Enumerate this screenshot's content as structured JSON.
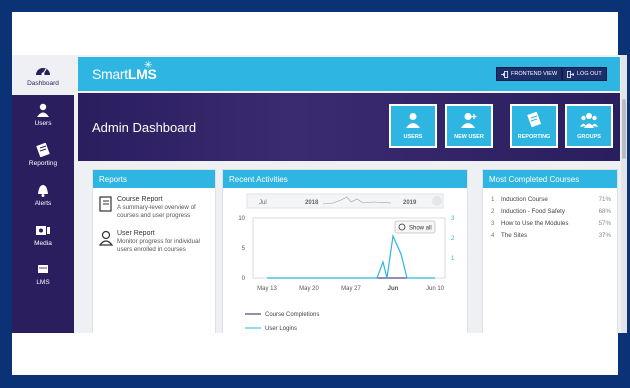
{
  "sidebar": {
    "items": [
      {
        "label": "Dashboard",
        "icon": "dashboard-icon"
      },
      {
        "label": "Users",
        "icon": "user-icon"
      },
      {
        "label": "Reporting",
        "icon": "reporting-icon"
      },
      {
        "label": "Alerts",
        "icon": "bell-icon"
      },
      {
        "label": "Media",
        "icon": "media-icon"
      }
    ],
    "lms_label": "LMS"
  },
  "topbar": {
    "logo_light": "Smart",
    "logo_bold": "LMS",
    "frontend_label": "FRONTEND VIEW",
    "logout_label": "LOG OUT"
  },
  "banner": {
    "title": "Admin Dashboard",
    "tiles": [
      {
        "label": "USERS",
        "icon": "user-icon"
      },
      {
        "label": "NEW USER",
        "icon": "add-user-icon"
      },
      {
        "label": "REPORTING",
        "icon": "reporting-icon"
      },
      {
        "label": "GROUPS",
        "icon": "groups-icon"
      }
    ]
  },
  "reports": {
    "title": "Reports",
    "items": [
      {
        "title": "Course Report",
        "desc": "A summary-level overview of courses and user progress",
        "icon": "book-icon"
      },
      {
        "title": "User Report",
        "desc": "Monitor progress for individual users enrolled in courses",
        "icon": "user-outline-icon"
      }
    ]
  },
  "activities": {
    "title": "Recent Activities",
    "show_all": "Show all",
    "navigator_labels": [
      "Jul",
      "2018",
      "2019"
    ],
    "legend": [
      "Course Completions",
      "User Logins"
    ]
  },
  "most_completed": {
    "title": "Most Completed Courses",
    "items": [
      {
        "num": "1",
        "name": "Induction Course",
        "pct": "71%"
      },
      {
        "num": "2",
        "name": "Induction - Food Safety",
        "pct": "68%"
      },
      {
        "num": "3",
        "name": "How to Use the Modules",
        "pct": "57%"
      },
      {
        "num": "4",
        "name": "The Sites",
        "pct": "37%"
      }
    ]
  },
  "colors": {
    "accent": "#2fb5e1",
    "sidebar": "#2a1e5e",
    "completions": "#2a1e5e",
    "logins": "#2fb5e1"
  },
  "chart_data": {
    "type": "line",
    "x": [
      "May 13",
      "May 20",
      "May 27",
      "Jun",
      "Jun 10"
    ],
    "yleft_ticks": [
      "0",
      "5",
      "10"
    ],
    "yright_ticks": [
      "1",
      "2",
      "3"
    ],
    "ylim_left": [
      0,
      10
    ],
    "ylim_right": [
      0,
      3
    ],
    "series": [
      {
        "name": "Course Completions",
        "values": [
          0,
          0,
          0,
          0,
          0
        ]
      },
      {
        "name": "User Logins",
        "values": [
          0,
          0,
          0,
          2.1,
          0
        ]
      }
    ]
  }
}
